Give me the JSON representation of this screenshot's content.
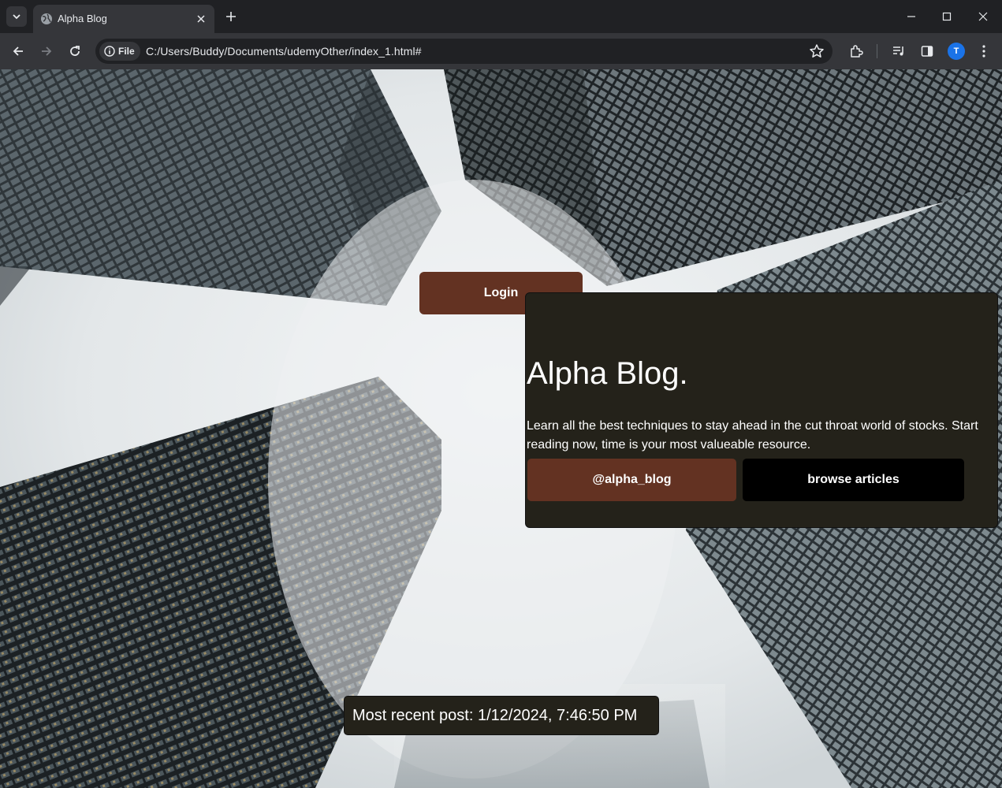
{
  "browser": {
    "tab_title": "Alpha Blog",
    "site_chip_label": "File",
    "url": "C:/Users/Buddy/Documents/udemyOther/index_1.html#",
    "profile_initial": "T"
  },
  "page": {
    "login_label": "Login",
    "hero": {
      "title": "Alpha Blog.",
      "description": "Learn all the best techniques to stay ahead in the cut throat world of stocks. Start reading now, time is your most valueable resource.",
      "handle_button": "@alpha_blog",
      "browse_button": "browse articles"
    },
    "recent_post": "Most recent post: 1/12/2024, 7:46:50 PM"
  },
  "colors": {
    "accent_brown": "#633222",
    "panel_dark": "#24221a",
    "browse_black": "#000000"
  },
  "icons": [
    "tab-search-icon",
    "globe-icon",
    "close-icon",
    "plus-icon",
    "minimize-icon",
    "maximize-icon",
    "window-close-icon",
    "back-icon",
    "forward-icon",
    "reload-icon",
    "info-icon",
    "star-icon",
    "extensions-icon",
    "media-icon",
    "sidepanel-icon",
    "kebab-menu-icon"
  ]
}
